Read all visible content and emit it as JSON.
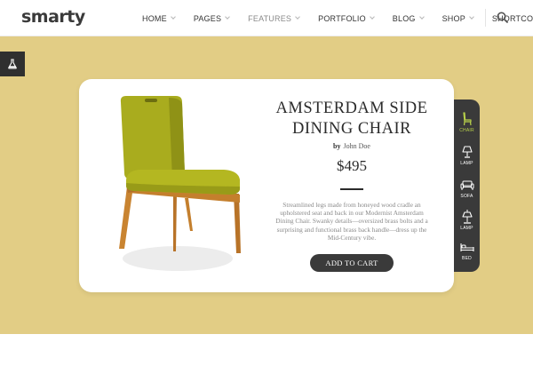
{
  "header": {
    "logo": "smarty",
    "nav": [
      {
        "label": "HOME",
        "dim": false
      },
      {
        "label": "PAGES",
        "dim": false
      },
      {
        "label": "FEATURES",
        "dim": true
      },
      {
        "label": "PORTFOLIO",
        "dim": false
      },
      {
        "label": "BLOG",
        "dim": false
      },
      {
        "label": "SHOP",
        "dim": false
      },
      {
        "label": "SHORTCODES",
        "dim": false
      }
    ],
    "search_icon": "search-icon"
  },
  "side_tab": {
    "icon": "flask-icon"
  },
  "product": {
    "title_line1": "AMSTERDAM SIDE",
    "title_line2": "DINING CHAIR",
    "by_label": "by",
    "author": "John Doe",
    "price": "$495",
    "description": "Streamlined legs made from honeyed wood cradle an upholstered seat and back in our Modernist Amsterdam Dining Chair. Swanky details—oversized brass bolts and a surprising and functional brass back handle—dress up the Mid-Century vibe.",
    "cta": "ADD TO CART"
  },
  "categories": [
    {
      "label": "CHAIR",
      "icon": "chair-icon",
      "active": true
    },
    {
      "label": "LAMP",
      "icon": "table-lamp-icon",
      "active": false
    },
    {
      "label": "SOFA",
      "icon": "sofa-icon",
      "active": false
    },
    {
      "label": "LAMP",
      "icon": "floor-lamp-icon",
      "active": false
    },
    {
      "label": "BED",
      "icon": "bed-icon",
      "active": false
    }
  ],
  "colors": {
    "hero_background": "#e2cd85",
    "dark": "#3a3a3a",
    "active_accent": "#b9d24a",
    "upholstery": "#a9ac1e",
    "wood": "#c47f2d"
  }
}
